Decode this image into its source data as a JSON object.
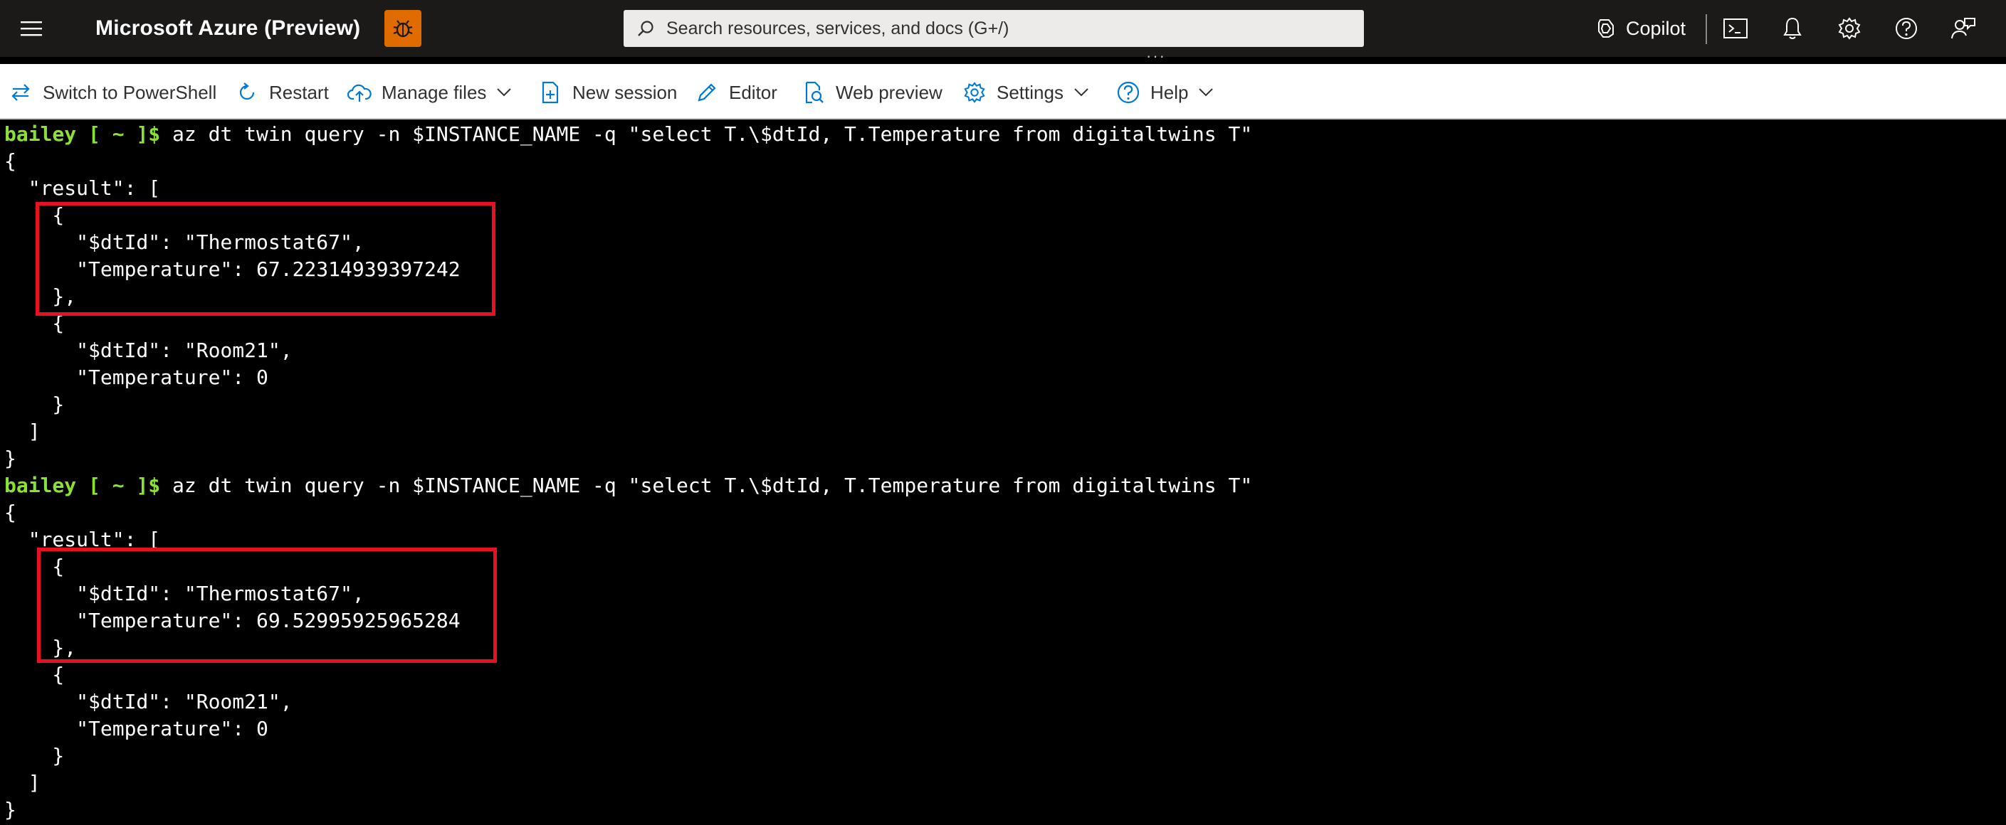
{
  "header": {
    "brand": "Microsoft Azure (Preview)",
    "search_placeholder": "Search resources, services, and docs (G+/)",
    "copilot_label": "Copilot",
    "icons": [
      "menu-icon",
      "bug-icon",
      "search-icon",
      "copilot-icon",
      "cloud-shell-icon",
      "bell-icon",
      "gear-icon",
      "help-icon",
      "feedback-icon"
    ],
    "accent_color": "#e06c00"
  },
  "toolbar": {
    "items": [
      {
        "label": "Switch to PowerShell",
        "icon": "switch-icon"
      },
      {
        "label": "Restart",
        "icon": "restart-icon"
      },
      {
        "label": "Manage files",
        "icon": "cloud-upload-icon",
        "has_dropdown": true
      },
      {
        "label": "New session",
        "icon": "new-session-icon"
      },
      {
        "label": "Editor",
        "icon": "pencil-icon"
      },
      {
        "label": "Web preview",
        "icon": "web-preview-icon"
      },
      {
        "label": "Settings",
        "icon": "gear-icon",
        "has_dropdown": true
      },
      {
        "label": "Help",
        "icon": "help-icon",
        "has_dropdown": true
      }
    ]
  },
  "terminal": {
    "prompt_user": "bailey",
    "prompt_path": " [ ~ ]$",
    "prompt_color": "#8ae234",
    "command": " az dt twin query -n $INSTANCE_NAME -q \"select T.\\$dtId, T.Temperature from digitaltwins T\"",
    "highlight_color": "#e81123",
    "output_block_1": [
      "{",
      "  \"result\": [",
      "    {",
      "      \"$dtId\": \"Thermostat67\",",
      "      \"Temperature\": 67.22314939397242",
      "    },",
      "    {",
      "      \"$dtId\": \"Room21\",",
      "      \"Temperature\": 0",
      "    }",
      "  ]",
      "}"
    ],
    "output_block_2": [
      "{",
      "  \"result\": [",
      "    {",
      "      \"$dtId\": \"Thermostat67\",",
      "      \"Temperature\": 69.52995925965284",
      "    },",
      "    {",
      "      \"$dtId\": \"Room21\",",
      "      \"Temperature\": 0",
      "    }",
      "  ]",
      "}"
    ]
  }
}
